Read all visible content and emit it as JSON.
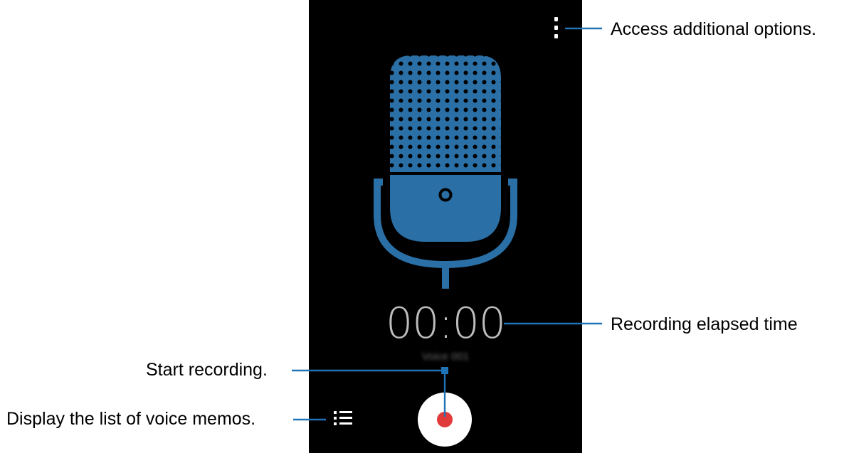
{
  "recorder": {
    "timer": "00:00",
    "file_name": "Voice 001",
    "colors": {
      "background": "#000000",
      "mic": "#2a6fa5",
      "timer": "#bdbdbd",
      "record": "#e03a3a",
      "callout_line": "#1f73b7"
    }
  },
  "callouts": {
    "options": "Access additional options.",
    "elapsed": "Recording elapsed time",
    "start": "Start recording.",
    "list": "Display the list of voice memos."
  },
  "icons": {
    "menu": "more-options-icon",
    "microphone": "microphone-icon",
    "list": "voice-memo-list-icon",
    "record": "record-icon"
  }
}
